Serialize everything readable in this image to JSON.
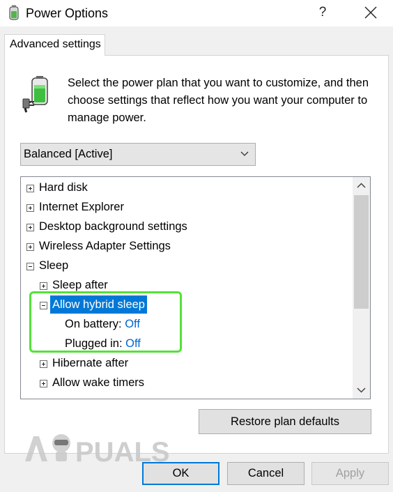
{
  "window": {
    "title": "Power Options",
    "help_label": "?",
    "close_icon": "close-icon"
  },
  "tab": {
    "label": "Advanced settings"
  },
  "intro": {
    "icon": "battery-plug-icon",
    "text": "Select the power plan that you want to customize, and then choose settings that reflect how you want your computer to manage power."
  },
  "plan_select": {
    "value": "Balanced [Active]",
    "icon": "chevron-down-icon"
  },
  "settings_tree": {
    "items": [
      {
        "label": "Hard disk",
        "state": "collapsed"
      },
      {
        "label": "Internet Explorer",
        "state": "collapsed"
      },
      {
        "label": "Desktop background settings",
        "state": "collapsed"
      },
      {
        "label": "Wireless Adapter Settings",
        "state": "collapsed"
      },
      {
        "label": "Sleep",
        "state": "expanded"
      },
      {
        "label": "Sleep after",
        "state": "collapsed"
      },
      {
        "label": "Allow hybrid sleep",
        "state": "expanded",
        "selected": true
      },
      {
        "label": "On battery:",
        "value": "Off"
      },
      {
        "label": "Plugged in:",
        "value": "Off"
      },
      {
        "label": "Hibernate after",
        "state": "collapsed"
      },
      {
        "label": "Allow wake timers",
        "state": "collapsed"
      }
    ],
    "highlight_color": "#56e03a",
    "selection_color": "#0078d7"
  },
  "restore_button": {
    "label": "Restore plan defaults"
  },
  "watermark": {
    "text": "A PUALS"
  },
  "buttons": {
    "ok": "OK",
    "cancel": "Cancel",
    "apply": "Apply"
  }
}
